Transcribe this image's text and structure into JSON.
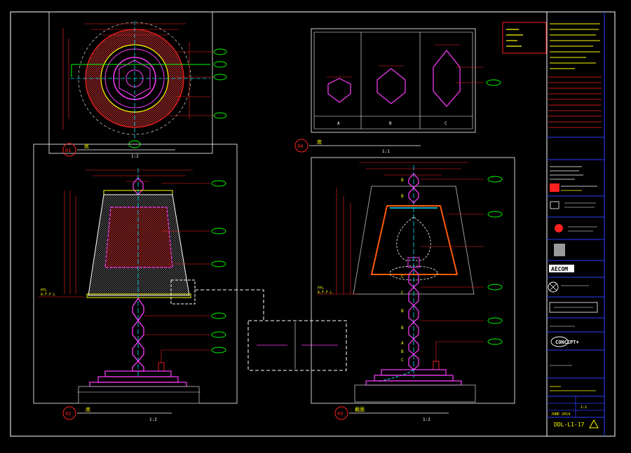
{
  "colors": {
    "frame": "#ffffff",
    "red": "#ff2020",
    "magenta": "#ff3cff",
    "yellow": "#ffff00",
    "green": "#00ff00",
    "cyan": "#00e5ff",
    "blue": "#2a3cff",
    "orange": "#ff6a00",
    "gray": "#9a9a9a"
  },
  "views": {
    "v01": {
      "num": "01",
      "title": "底",
      "scale": "1:2"
    },
    "v02": {
      "num": "02",
      "title": "底",
      "scale": "1:2"
    },
    "v03": {
      "num": "03",
      "title": "截面",
      "scale": "1:2"
    },
    "v04": {
      "num": "04",
      "title": "底",
      "scale": "1:1",
      "options": [
        "A",
        "B",
        "C"
      ]
    }
  },
  "heights": {
    "h1": "FFL",
    "h2": "A.F.F.L"
  },
  "beads_right": [
    "B",
    "B",
    "C",
    "C",
    "B",
    "B",
    "A",
    "B",
    "C"
  ],
  "title_block": {
    "aecom": "AECOM",
    "concept": "CONCEPT+",
    "drawing_no": "DDL-L1-17",
    "date": "JUNE 2014",
    "scale_label": "1:2"
  }
}
